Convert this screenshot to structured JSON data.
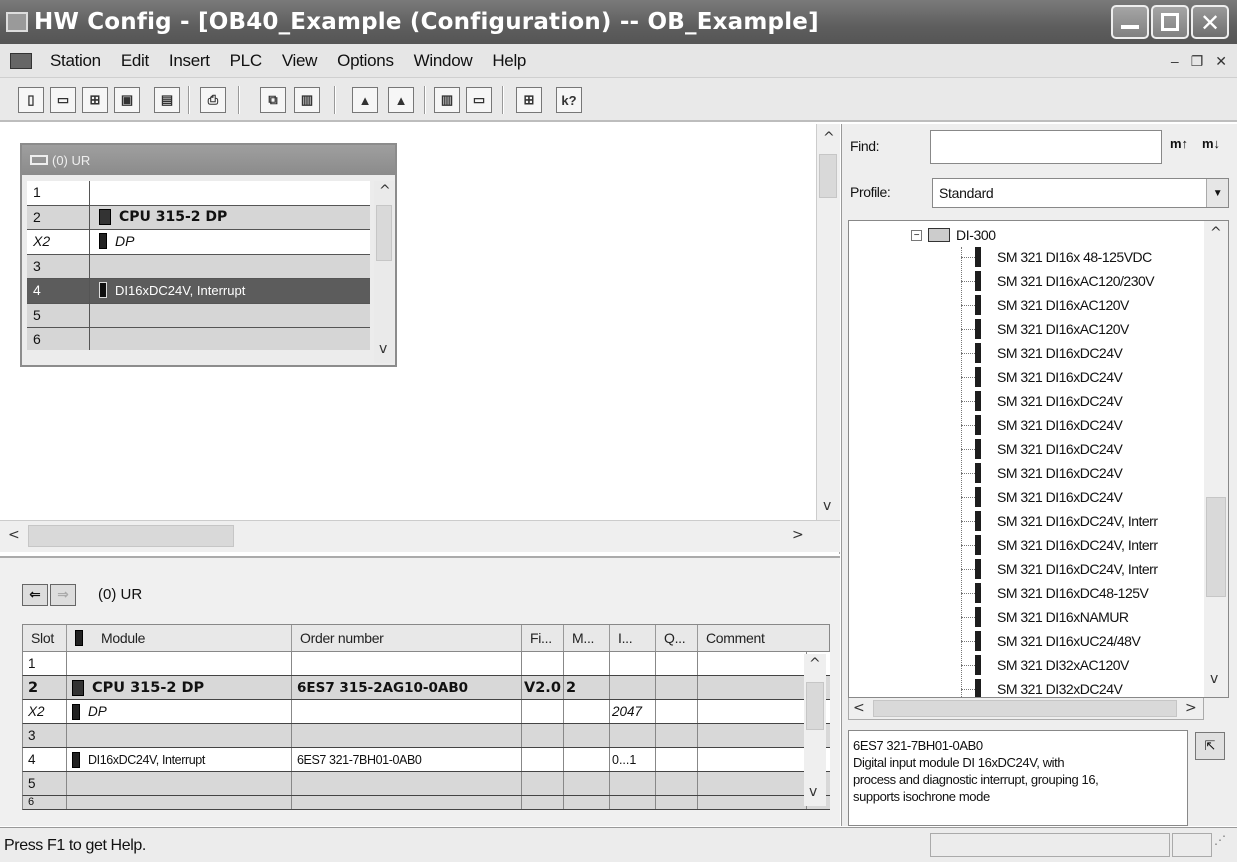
{
  "window": {
    "title": "HW Config - [OB40_Example (Configuration) -- OB_Example]"
  },
  "menu": [
    "Station",
    "Edit",
    "Insert",
    "PLC",
    "View",
    "Options",
    "Window",
    "Help"
  ],
  "toolbar": {
    "buttons": [
      "new-icon",
      "open-icon",
      "save-compile-icon",
      "save-icon",
      "print-preview-icon",
      "print-icon",
      "copy-icon",
      "paste-icon",
      "download-icon",
      "upload-icon",
      "catalog-icon",
      "view-icon",
      "network-icon",
      "whats-this-icon"
    ],
    "help_label": "k?"
  },
  "rack": {
    "title": "(0) UR",
    "rows": [
      {
        "slot": "1",
        "module": "",
        "style": "white"
      },
      {
        "slot": "2",
        "module": "CPU 315-2 DP",
        "style": "gray",
        "bold": true,
        "icon": "cpu"
      },
      {
        "slot": "X2",
        "module": "DP",
        "style": "white",
        "italic": true,
        "icon": "module"
      },
      {
        "slot": "3",
        "module": "",
        "style": "gray"
      },
      {
        "slot": "4",
        "module": "DI16xDC24V, Interrupt",
        "style": "sel",
        "icon": "module"
      },
      {
        "slot": "5",
        "module": "",
        "style": "gray"
      },
      {
        "slot": "6",
        "module": "",
        "style": "gray"
      }
    ]
  },
  "detail": {
    "title": "(0)  UR",
    "columns": [
      "Slot",
      "Module",
      "Order number",
      "Fi...",
      "M...",
      "I...",
      "Q...",
      "Comment"
    ],
    "rows": [
      {
        "slot": "1",
        "module": "",
        "order": "",
        "fw": "",
        "mpi": "",
        "i": "",
        "q": "",
        "comment": "",
        "style": "white"
      },
      {
        "slot": "2",
        "module": "CPU 315-2 DP",
        "order": "6ES7 315-2AG10-0AB0",
        "fw": "V2.0",
        "mpi": "2",
        "i": "",
        "q": "",
        "comment": "",
        "style": "gray",
        "bold": true
      },
      {
        "slot": "X2",
        "module": "DP",
        "order": "",
        "fw": "",
        "mpi": "",
        "i": "2047",
        "q": "",
        "comment": "",
        "style": "white",
        "italic": true
      },
      {
        "slot": "3",
        "module": "",
        "order": "",
        "fw": "",
        "mpi": "",
        "i": "",
        "q": "",
        "comment": "",
        "style": "gray"
      },
      {
        "slot": "4",
        "module": "DI16xDC24V, Interrupt",
        "order": "6ES7 321-7BH01-0AB0",
        "fw": "",
        "mpi": "",
        "i": "0...1",
        "q": "",
        "comment": "",
        "style": "white"
      },
      {
        "slot": "5",
        "module": "",
        "order": "",
        "fw": "",
        "mpi": "",
        "i": "",
        "q": "",
        "comment": "",
        "style": "gray"
      },
      {
        "slot": "6",
        "module": "",
        "order": "",
        "fw": "",
        "mpi": "",
        "i": "",
        "q": "",
        "comment": "",
        "style": "gray"
      }
    ]
  },
  "catalog": {
    "find_label": "Find:",
    "find_value": "",
    "find_next_label": "m↑",
    "find_prev_label": "m↓",
    "profile_label": "Profile:",
    "profile_value": "Standard",
    "folder": "DI-300",
    "items": [
      "SM 321 DI16x 48-125VDC",
      "SM 321 DI16xAC120/230V",
      "SM 321 DI16xAC120V",
      "SM 321 DI16xAC120V",
      "SM 321 DI16xDC24V",
      "SM 321 DI16xDC24V",
      "SM 321 DI16xDC24V",
      "SM 321 DI16xDC24V",
      "SM 321 DI16xDC24V",
      "SM 321 DI16xDC24V",
      "SM 321 DI16xDC24V",
      "SM 321 DI16xDC24V, Interr",
      "SM 321 DI16xDC24V, Interr",
      "SM 321 DI16xDC24V, Interr",
      "SM 321 DI16xDC48-125V",
      "SM 321 DI16xNAMUR",
      "SM 321 DI16xUC24/48V",
      "SM 321 DI32xAC120V",
      "SM 321 DI32xDC24V"
    ],
    "info_lines": [
      "6ES7 321-7BH01-0AB0",
      "Digital input module DI 16xDC24V, with",
      "process and diagnostic interrupt,  grouping 16,",
      "supports isochrone mode"
    ]
  },
  "status": {
    "text": "Press F1 to get Help."
  }
}
